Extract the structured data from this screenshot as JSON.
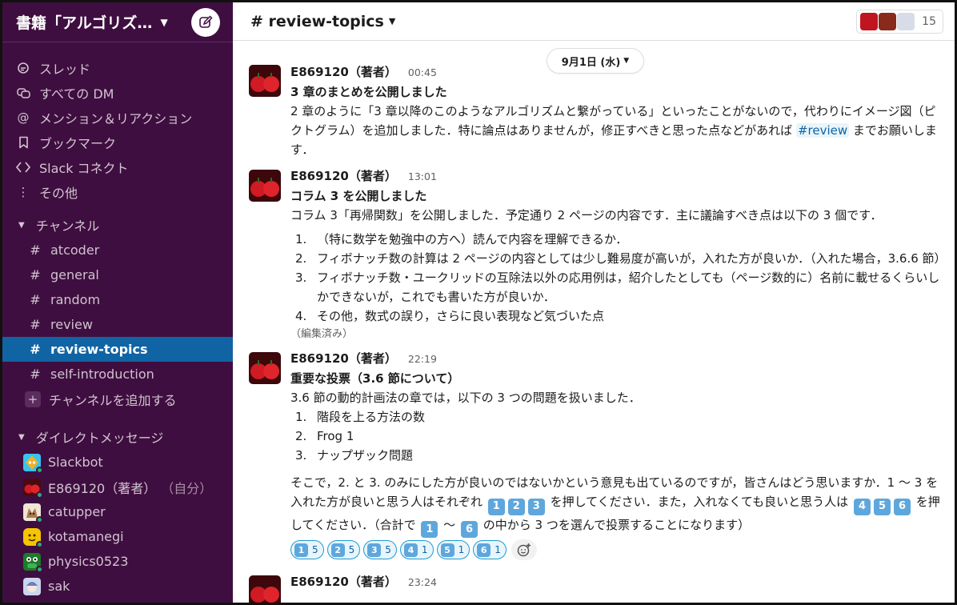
{
  "workspace": {
    "name": "書籍「アルゴリズ…"
  },
  "sidebar": {
    "nav": [
      {
        "label": "スレッド",
        "icon": "threads-icon"
      },
      {
        "label": "すべての DM",
        "icon": "dm-icon"
      },
      {
        "label": "メンション＆リアクション",
        "icon": "mention-icon"
      },
      {
        "label": "ブックマーク",
        "icon": "bookmark-icon"
      },
      {
        "label": "Slack コネクト",
        "icon": "connect-icon"
      },
      {
        "label": "その他",
        "icon": "more-icon"
      }
    ],
    "channels_header": "チャンネル",
    "channels": [
      "atcoder",
      "general",
      "random",
      "review",
      "review-topics",
      "self-introduction"
    ],
    "add_channel": "チャンネルを追加する",
    "dm_header": "ダイレクトメッセージ",
    "dms": [
      {
        "name": "Slackbot"
      },
      {
        "name": "E869120（著者）",
        "self": "（自分）"
      },
      {
        "name": "catupper"
      },
      {
        "name": "kotamanegi"
      },
      {
        "name": "physics0523"
      },
      {
        "name": "sak"
      }
    ]
  },
  "channel": {
    "title": "# review-topics",
    "member_count": "15"
  },
  "date_divider": "9月1日 (水)",
  "messages": [
    {
      "author": "E869120（著者）",
      "time": "00:45",
      "title": "3 章のまとめを公開しました",
      "body_pre": "2 章のように「3 章以降のこのようなアルゴリズムと繋がっている」といったことがないので，代わりにイメージ図（ピクトグラム）を追加しました．特に論点はありませんが，修正すべきと思った点などがあれば",
      "link": "#review",
      "body_post": "までお願いします．"
    },
    {
      "author": "E869120（著者）",
      "time": "13:01",
      "title": "コラム 3 を公開しました",
      "body": "コラム 3「再帰関数」を公開しました．予定通り 2 ページの内容です．主に議論すべき点は以下の 3 個です．",
      "items": [
        "（特に数学を勉強中の方へ）読んで内容を理解できるか．",
        "フィボナッチ数の計算は 2 ページの内容としては少し難易度が高いが，入れた方が良いか．（入れた場合，3.6.6 節）",
        "フィボナッチ数・ユークリッドの互除法以外の応用例は，紹介したとしても（ページ数的に）名前に載せるくらいしかできないが，これでも書いた方が良いか．",
        "その他，数式の誤り，さらに良い表現など気づいた点"
      ],
      "edited": "（編集済み）"
    },
    {
      "author": "E869120（著者）",
      "time": "22:19",
      "title": "重要な投票（3.6 節について）",
      "body": "3.6 節の動的計画法の章では，以下の 3 つの問題を扱いました．",
      "items": [
        "階段を上る方法の数",
        "Frog 1",
        "ナップザック問題"
      ],
      "p2_a": "そこで，2. と 3. のみにした方が良いのではないかという意見も出ているのですが，皆さんはどう思いますか．1 〜 3 を入れた方が良いと思う人はそれぞれ",
      "p2_b": "を押してください．また，入れなくても良いと思う人は",
      "p2_c": "を押してください．（合計で",
      "p2_d": "〜",
      "p2_e": "の中から 3 つを選んで投票することになります）",
      "keycaps": [
        "1",
        "2",
        "3",
        "4",
        "5",
        "6"
      ],
      "reactions": [
        {
          "emoji": "1",
          "count": "5"
        },
        {
          "emoji": "2",
          "count": "5"
        },
        {
          "emoji": "3",
          "count": "5"
        },
        {
          "emoji": "4",
          "count": "1"
        },
        {
          "emoji": "5",
          "count": "1"
        },
        {
          "emoji": "6",
          "count": "1"
        }
      ]
    },
    {
      "author": "E869120（著者）",
      "time": "23:24"
    }
  ],
  "colors": {
    "sidebar": "#3f0e40",
    "active": "#1164a3",
    "link": "#1264a3",
    "keycap": "#5ea7dd"
  }
}
